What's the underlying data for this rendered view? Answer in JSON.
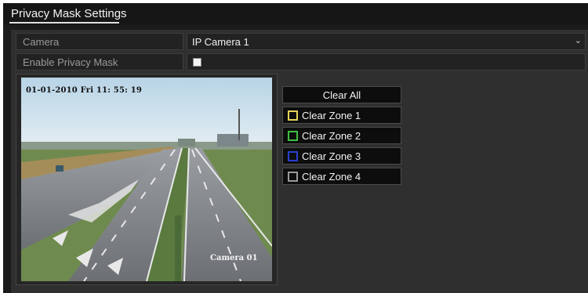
{
  "window": {
    "title": "Privacy Mask Settings"
  },
  "form": {
    "camera_label": "Camera",
    "camera_value": "IP Camera 1",
    "enable_label": "Enable Privacy Mask",
    "enable_checked": false
  },
  "video": {
    "osd_time": "01-01-2010  Fri  11: 55: 19",
    "osd_camera": "Camera 01"
  },
  "buttons": {
    "clear_all": "Clear All",
    "zones": [
      {
        "label": "Clear Zone 1",
        "color": "#e8d35a"
      },
      {
        "label": "Clear Zone 2",
        "color": "#3fbf3f"
      },
      {
        "label": "Clear Zone 3",
        "color": "#2a3fd0"
      },
      {
        "label": "Clear Zone 4",
        "color": "#9a9a9a"
      }
    ]
  },
  "icons": {
    "dropdown": "chevron-down-icon",
    "checkbox": "checkbox-icon"
  }
}
